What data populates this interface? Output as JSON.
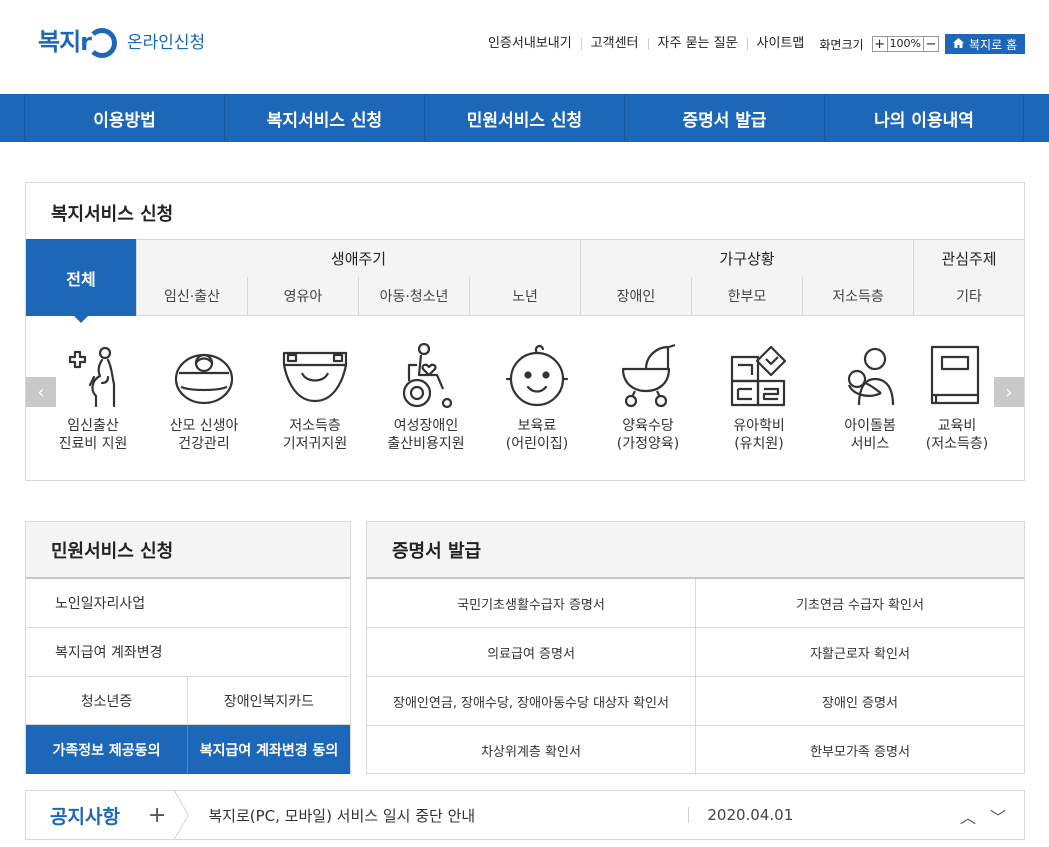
{
  "header": {
    "logo_text": "복지r",
    "logo_sub": "온라인신청",
    "util_links": [
      "인증서내보내기",
      "고객센터",
      "자주 묻는 질문",
      "사이트맵"
    ],
    "zoom_label": "화면크기",
    "zoom_plus": "+",
    "zoom_value": "100%",
    "zoom_minus": "−",
    "home_button": "복지로 홈"
  },
  "gnb": [
    "이용방법",
    "복지서비스 신청",
    "민원서비스 신청",
    "증명서 발급",
    "나의 이용내역"
  ],
  "welfare": {
    "title": "복지서비스 신청",
    "tab_all": "전체",
    "categories": [
      "생애주기",
      "가구상황",
      "관심주제"
    ],
    "subcategories": [
      "임신·출산",
      "영유아",
      "아동·청소년",
      "노년",
      "장애인",
      "한부모",
      "저소득층",
      "기타"
    ],
    "services": [
      {
        "label": "임신출산\n진료비 지원",
        "icon": "pregnant-woman-icon"
      },
      {
        "label": "산모 신생아\n건강관리",
        "icon": "baby-basket-icon"
      },
      {
        "label": "저소득층\n기저귀지원",
        "icon": "diaper-icon"
      },
      {
        "label": "여성장애인\n출산비용지원",
        "icon": "wheelchair-icon"
      },
      {
        "label": "보육료\n(어린이집)",
        "icon": "baby-face-icon"
      },
      {
        "label": "양육수당\n(가정양육)",
        "icon": "stroller-icon"
      },
      {
        "label": "유아학비\n(유치원)",
        "icon": "letter-blocks-icon"
      },
      {
        "label": "아이돌봄\n서비스",
        "icon": "caregiver-icon"
      },
      {
        "label": "교육비\n(저소득층)",
        "icon": "book-icon"
      }
    ],
    "prev_arrow": "‹",
    "next_arrow": "›"
  },
  "civil": {
    "title": "민원서비스 신청",
    "row1": "노인일자리사업",
    "row2": "복지급여 계좌변경",
    "split_left": "청소년증",
    "split_right": "장애인복지카드",
    "blue_left": "가족정보 제공동의",
    "blue_right": "복지급여 계좌변경 동의"
  },
  "cert": {
    "title": "증명서 발급",
    "items": [
      "국민기초생활수급자 증명서",
      "기초연금 수급자 확인서",
      "의료급여 증명서",
      "자활근로자 확인서",
      "장애인연금, 장애수당, 장애아동수당 대상자 확인서",
      "장애인 증명서",
      "차상위계층 확인서",
      "한부모가족 증명서"
    ]
  },
  "notice": {
    "title": "공지사항",
    "plus": "+",
    "text": "복지로(PC, 모바일) 서비스 일시 중단 안내",
    "date": "2020.04.01",
    "up": "︿",
    "down": "﹀"
  },
  "colors": {
    "brand_blue": "#1d67b9",
    "border": "#d8d8d8",
    "header_bg": "#f4f4f4"
  }
}
